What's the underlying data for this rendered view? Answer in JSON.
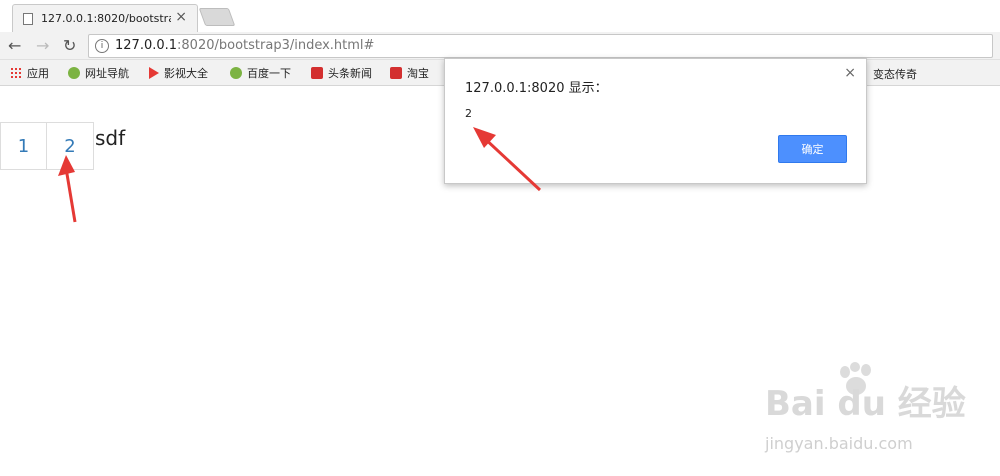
{
  "browser": {
    "tab_title": "127.0.0.1:8020/bootstrap3/index.html#",
    "tab_close": "×",
    "url_host": "127.0.0.1",
    "url_rest": ":8020/bootstrap3/index.html#",
    "info_icon": "i"
  },
  "bookmarks": [
    {
      "label": "应用",
      "icon": "apps-icon"
    },
    {
      "label": "网址导航",
      "icon": "green-icon"
    },
    {
      "label": "影视大全",
      "icon": "play-icon"
    },
    {
      "label": "百度一下",
      "icon": "green-icon"
    },
    {
      "label": "头条新闻",
      "icon": "red-icon"
    },
    {
      "label": "淘宝",
      "icon": "red-icon"
    },
    {
      "label": "变态传奇",
      "icon": "none"
    }
  ],
  "page": {
    "pagination": [
      "1",
      "2"
    ],
    "text": "sdf"
  },
  "dialog": {
    "title": "127.0.0.1:8020 显示：",
    "close": "×",
    "message": "2",
    "ok_label": "确定"
  },
  "watermark": {
    "brand": "Bai du 经验",
    "url": "jingyan.baidu.com"
  },
  "colors": {
    "link": "#337ab7",
    "button": "#4d90fe",
    "arrow": "#e53935"
  }
}
